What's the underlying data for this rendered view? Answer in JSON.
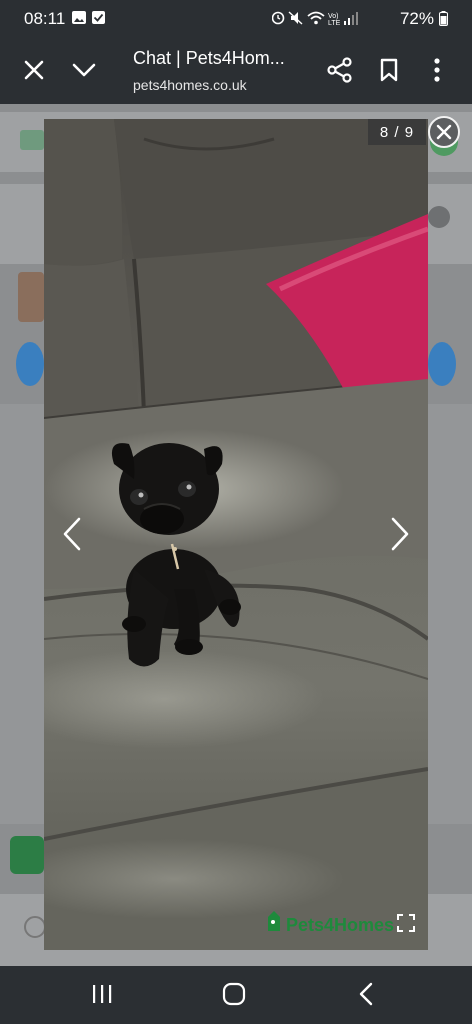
{
  "status_bar": {
    "time": "08:11",
    "battery": "72%",
    "network": "Vo) LTE"
  },
  "browser": {
    "title": "Chat | Pets4Hom...",
    "url": "pets4homes.co.uk"
  },
  "gallery": {
    "counter": "8 / 9",
    "watermark": "Pets4Homes",
    "accent_color": "#1e8a3c"
  },
  "icons": [
    "close-icon",
    "chevron-down-icon",
    "share-icon",
    "bookmark-icon",
    "more-vert-icon",
    "chevron-left-icon",
    "chevron-right-icon",
    "fullscreen-icon",
    "recents-icon",
    "home-icon",
    "back-icon"
  ]
}
